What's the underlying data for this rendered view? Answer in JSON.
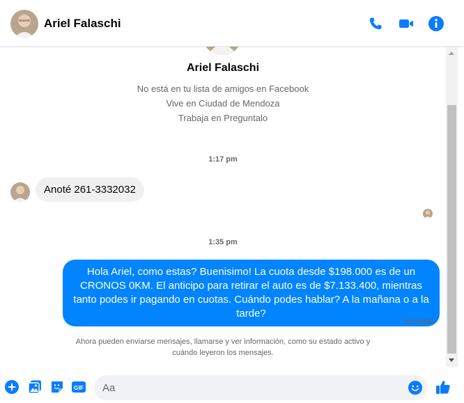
{
  "header": {
    "contact_name": "Ariel Falaschi",
    "icons": [
      "phone-icon",
      "video-camera-icon",
      "info-icon"
    ]
  },
  "profile": {
    "name": "Ariel Falaschi",
    "lines": [
      "No está en tu lista de amigos en Facebook",
      "Vive en Ciudad de Mendoza",
      "Trabaja en Preguntalo"
    ]
  },
  "conversation": {
    "timestamp_1": "1:17 pm",
    "incoming_message": "Anoté 261-3332032",
    "timestamp_2": "1:35 pm",
    "outgoing_message": "Hola Ariel, como estas? Buenisimo! La cuota desde $198.000 es de un CRONOS 0KM. El anticipo para retirar el auto es de $7.133.400, mientras tanto podes ir pagando en cuotas. Cuándo podes hablar? A la mañana o a la tarde?",
    "sent_status": "Enviado",
    "info_note": "Ahora pueden enviarse mensajes, llamarse y ver información, como su estado activo y cuándo leyeron los mensajes."
  },
  "composer": {
    "placeholder": "Aa",
    "value": "",
    "gif_label": "GIF",
    "icons": [
      "plus-icon",
      "photo-icon",
      "sticker-icon",
      "gif-icon",
      "emoji-icon",
      "thumbs-up-icon"
    ]
  },
  "colors": {
    "accent": "#0084ff",
    "icon_blue": "#0a7cff",
    "incoming_bubble": "#f0f0f0",
    "secondary_text": "#65676b"
  }
}
